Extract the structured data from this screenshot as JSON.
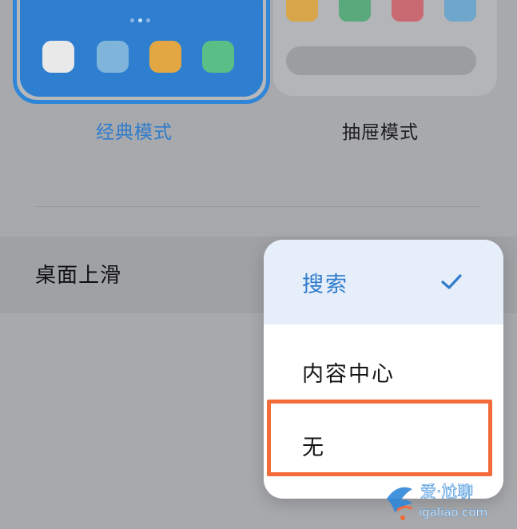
{
  "layout_modes": {
    "classic_label": "经典模式",
    "drawer_label": "抽屉模式",
    "classic_app_colors": [
      "#e9e9e9",
      "#7fb4db",
      "#e2a743",
      "#58bf87"
    ],
    "drawer_app_colors": [
      "#d8a54a",
      "#5aa97c",
      "#c96a72",
      "#6fa6cc"
    ]
  },
  "swipe_setting": {
    "label": "桌面上滑"
  },
  "dropdown": {
    "options": [
      {
        "label": "搜索",
        "selected": true
      },
      {
        "label": "内容中心",
        "selected": false
      },
      {
        "label": "无",
        "selected": false
      }
    ],
    "check_icon": "check-icon"
  },
  "colors": {
    "accent": "#2f7ccc",
    "highlight": "#f26b3a"
  },
  "watermark": {
    "title": "爱·尬聊",
    "url": "igaliao.com"
  }
}
